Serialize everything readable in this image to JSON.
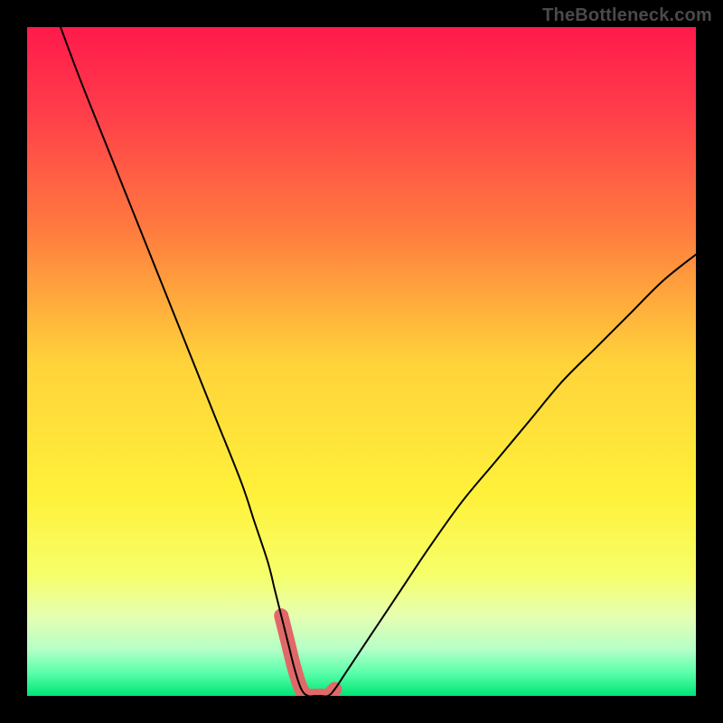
{
  "watermark": "TheBottleneck.com",
  "colors": {
    "frame": "#000000",
    "curve": "#000000",
    "highlight": "#e06868",
    "gradient_stops": [
      {
        "offset": 0.0,
        "color": "#ff1a4b"
      },
      {
        "offset": 0.12,
        "color": "#ff3b4a"
      },
      {
        "offset": 0.3,
        "color": "#ff7a3f"
      },
      {
        "offset": 0.5,
        "color": "#ffd23a"
      },
      {
        "offset": 0.7,
        "color": "#fff13a"
      },
      {
        "offset": 0.82,
        "color": "#f6ff6a"
      },
      {
        "offset": 0.88,
        "color": "#e6ffb0"
      },
      {
        "offset": 0.93,
        "color": "#b6ffc8"
      },
      {
        "offset": 0.965,
        "color": "#5bffab"
      },
      {
        "offset": 1.0,
        "color": "#00e575"
      }
    ]
  },
  "chart_data": {
    "type": "line",
    "title": "",
    "xlabel": "",
    "ylabel": "",
    "xlim": [
      0,
      100
    ],
    "ylim": [
      0,
      100
    ],
    "grid": false,
    "legend": false,
    "series": [
      {
        "name": "bottleneck-curve",
        "x": [
          5,
          8,
          12,
          16,
          20,
          24,
          28,
          32,
          34,
          36,
          37,
          38,
          39,
          40,
          41,
          42,
          43,
          44,
          45,
          46,
          48,
          52,
          56,
          60,
          65,
          70,
          75,
          80,
          85,
          90,
          95,
          100
        ],
        "y": [
          100,
          92,
          82,
          72,
          62,
          52,
          42,
          32,
          26,
          20,
          16,
          12,
          8,
          4,
          1,
          0,
          0,
          0,
          0,
          1,
          4,
          10,
          16,
          22,
          29,
          35,
          41,
          47,
          52,
          57,
          62,
          66
        ]
      }
    ],
    "highlight_range_x": [
      38,
      47
    ],
    "annotations": []
  }
}
